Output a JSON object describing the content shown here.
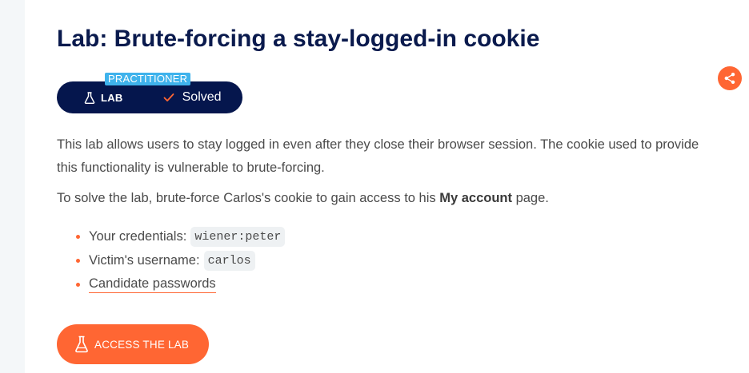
{
  "lab": {
    "title": "Lab: Brute-forcing a stay-logged-in cookie",
    "level": "PRACTITIONER",
    "lab_label": "LAB",
    "status": "Solved"
  },
  "description": {
    "p1": "This lab allows users to stay logged in even after they close their browser session. The cookie used to provide this functionality is vulnerable to brute-forcing.",
    "p2_before": "To solve the lab, brute-force Carlos's cookie to gain access to his ",
    "p2_strong": "My account",
    "p2_after": " page."
  },
  "bullets": {
    "credentials_label": "Your credentials:",
    "credentials_value": "wiener:peter",
    "victim_label": "Victim's username:",
    "victim_value": "carlos",
    "passwords_link": "Candidate passwords"
  },
  "access_button": "ACCESS THE LAB",
  "icons": {
    "flask": "flask-icon",
    "check": "check-icon",
    "share": "share-icon"
  },
  "colors": {
    "title": "#0a1a4d",
    "pill": "#05164d",
    "level_tag": "#3fb3ec",
    "accent": "#ff6633"
  }
}
